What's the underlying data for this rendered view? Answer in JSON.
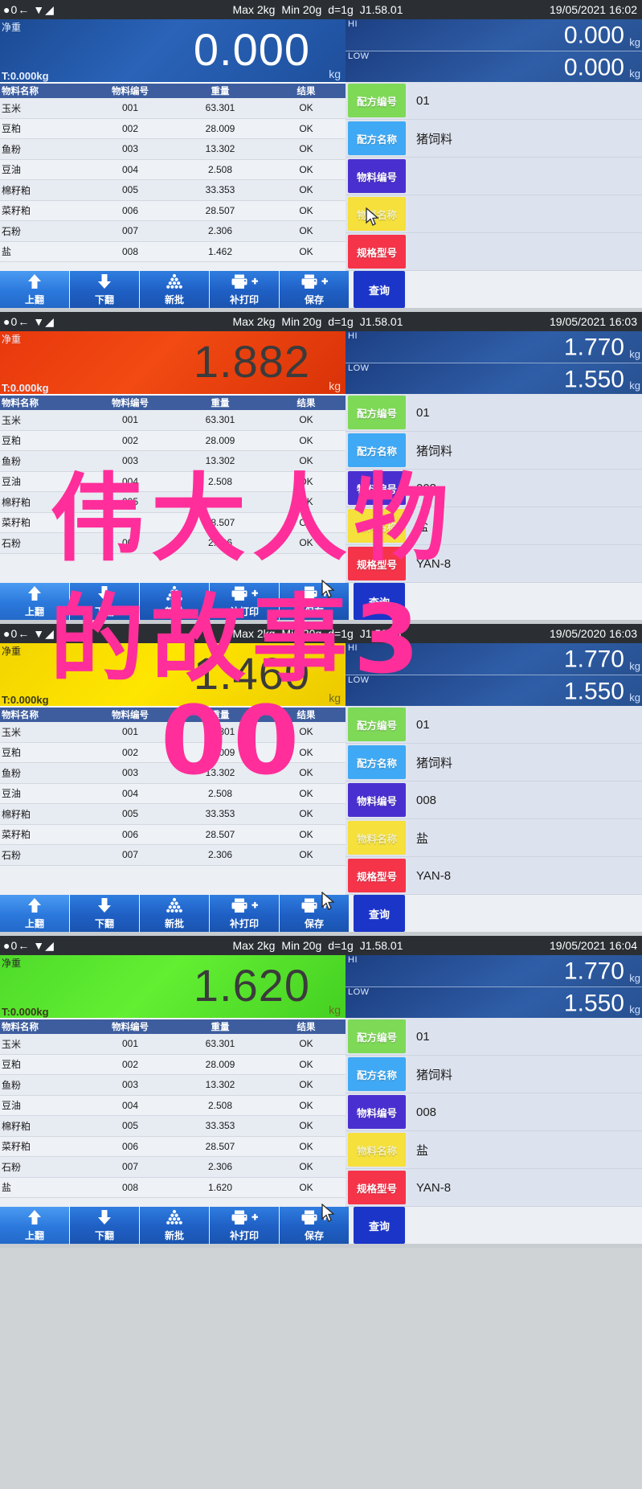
{
  "device": {
    "status_icons": [
      "zero-icon",
      "tare-icon",
      "stable-icon"
    ],
    "spec_max": "Max 2kg",
    "spec_min": "Min 20g",
    "spec_division": "d=1g",
    "firmware": "J1.58.01"
  },
  "labels": {
    "net_weight": "净重",
    "tare": "T:0.000kg",
    "unit_kg": "kg",
    "hi": "HI",
    "low": "LOW"
  },
  "table": {
    "headers": [
      "物料名称",
      "物料编号",
      "重量",
      "结果"
    ],
    "rows_full": [
      {
        "name": "玉米",
        "code": "001",
        "weight": "63.301",
        "result": "OK"
      },
      {
        "name": "豆粕",
        "code": "002",
        "weight": "28.009",
        "result": "OK"
      },
      {
        "name": "鱼粉",
        "code": "003",
        "weight": "13.302",
        "result": "OK"
      },
      {
        "name": "豆油",
        "code": "004",
        "weight": "2.508",
        "result": "OK"
      },
      {
        "name": "棉籽粕",
        "code": "005",
        "weight": "33.353",
        "result": "OK"
      },
      {
        "name": "菜籽粕",
        "code": "006",
        "weight": "28.507",
        "result": "OK"
      },
      {
        "name": "石粉",
        "code": "007",
        "weight": "2.306",
        "result": "OK"
      },
      {
        "name": "盐",
        "code": "008",
        "weight": "1.462",
        "result": "OK"
      }
    ],
    "rows_seven": [
      {
        "name": "玉米",
        "code": "001",
        "weight": "63.301",
        "result": "OK"
      },
      {
        "name": "豆粕",
        "code": "002",
        "weight": "28.009",
        "result": "OK"
      },
      {
        "name": "鱼粉",
        "code": "003",
        "weight": "13.302",
        "result": "OK"
      },
      {
        "name": "豆油",
        "code": "004",
        "weight": "2.508",
        "result": "OK"
      },
      {
        "name": "棉籽粕",
        "code": "005",
        "weight": "33.353",
        "result": "OK"
      },
      {
        "name": "菜籽粕",
        "code": "006",
        "weight": "28.507",
        "result": "OK"
      },
      {
        "name": "石粉",
        "code": "007",
        "weight": "2.306",
        "result": "OK"
      }
    ],
    "rows_last_162": [
      {
        "name": "玉米",
        "code": "001",
        "weight": "63.301",
        "result": "OK"
      },
      {
        "name": "豆粕",
        "code": "002",
        "weight": "28.009",
        "result": "OK"
      },
      {
        "name": "鱼粉",
        "code": "003",
        "weight": "13.302",
        "result": "OK"
      },
      {
        "name": "豆油",
        "code": "004",
        "weight": "2.508",
        "result": "OK"
      },
      {
        "name": "棉籽粕",
        "code": "005",
        "weight": "33.353",
        "result": "OK"
      },
      {
        "name": "菜籽粕",
        "code": "006",
        "weight": "28.507",
        "result": "OK"
      },
      {
        "name": "石粉",
        "code": "007",
        "weight": "2.306",
        "result": "OK"
      },
      {
        "name": "盐",
        "code": "008",
        "weight": "1.620",
        "result": "OK"
      }
    ]
  },
  "sidebar_keys": {
    "recipe_code": "配方编号",
    "recipe_name": "配方名称",
    "material_code": "物料编号",
    "material_name": "物料名称",
    "spec_model": "规格型号"
  },
  "buttons": {
    "page_up": "上翻",
    "page_down": "下翻",
    "new_batch": "新批",
    "reprint": "补打印",
    "save": "保存",
    "query": "查询"
  },
  "colors": {
    "key_green": "#7ed957",
    "key_blue": "#3fa9f5",
    "key_purple": "#4a2fd0",
    "key_yellow": "#f5e03c",
    "key_red": "#f5344a",
    "query_blue": "#1b35c9",
    "weight_blue": "#2a63b8",
    "weight_red": "#f24a12",
    "weight_yellow": "#ffe600",
    "weight_green": "#62ef32",
    "watermark_pink": "#ff2e9a"
  },
  "panels": [
    {
      "id": "panel-1",
      "datetime": "19/05/2021  16:02",
      "weight": "0.000",
      "weight_color": "blue",
      "hi": "0.000",
      "low": "0.000",
      "values": {
        "recipe_code": "01",
        "recipe_name": "猪饲料",
        "material_code": "",
        "material_name": "",
        "spec_model": ""
      },
      "rows_key": "rows_full"
    },
    {
      "id": "panel-2",
      "datetime": "19/05/2021  16:03",
      "weight": "1.882",
      "weight_color": "red",
      "hi": "1.770",
      "low": "1.550",
      "values": {
        "recipe_code": "01",
        "recipe_name": "猪饲料",
        "material_code": "008",
        "material_name": "盐",
        "spec_model": "YAN-8"
      },
      "rows_key": "rows_seven"
    },
    {
      "id": "panel-3",
      "datetime": "19/05/2020  16:03",
      "weight": "1.460",
      "weight_color": "yellow",
      "hi": "1.770",
      "low": "1.550",
      "values": {
        "recipe_code": "01",
        "recipe_name": "猪饲料",
        "material_code": "008",
        "material_name": "盐",
        "spec_model": "YAN-8"
      },
      "rows_key": "rows_seven"
    },
    {
      "id": "panel-4",
      "datetime": "19/05/2021  16:04",
      "weight": "1.620",
      "weight_color": "green",
      "hi": "1.770",
      "low": "1.550",
      "values": {
        "recipe_code": "01",
        "recipe_name": "猪饲料",
        "material_code": "008",
        "material_name": "盐",
        "spec_model": "YAN-8"
      },
      "rows_key": "rows_last_162"
    }
  ],
  "watermark": {
    "line1": "伟大人物",
    "line2": "的故事3",
    "line3": "00"
  }
}
